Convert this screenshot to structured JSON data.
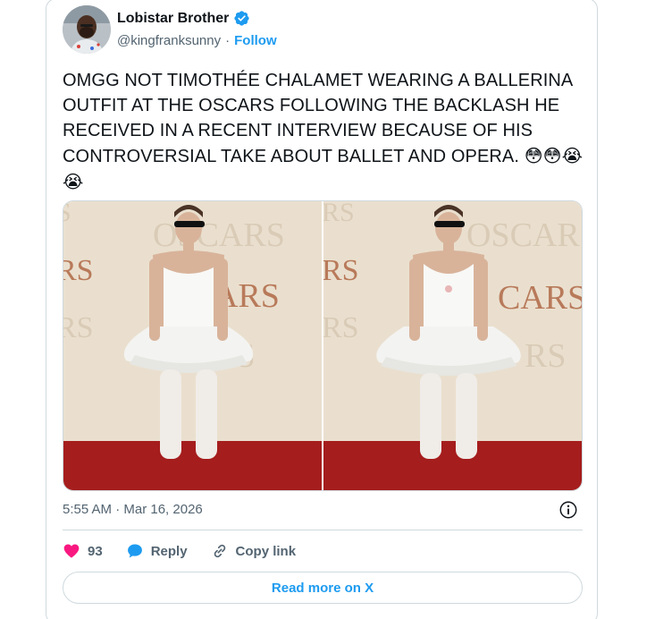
{
  "author": {
    "display_name": "Lobistar Brother",
    "handle": "@kingfranksunny",
    "separator": "·",
    "follow_label": "Follow"
  },
  "tweet": {
    "text": "OMGG NOT TIMOTHÉE CHALAMET WEARING A BALLERINA OUTFIT AT THE OSCARS FOLLOWING THE BACKLASH HE RECEIVED IN A RECENT INTERVIEW BECAUSE OF HIS CONTROVERSIAL TAKE ABOUT BALLET AND OPERA.",
    "emojis": "😳😳😭😭",
    "media": [
      {
        "name": "photo-1",
        "backdrop_text": "OSCARS"
      },
      {
        "name": "photo-2",
        "backdrop_text": "OSCARS"
      }
    ],
    "timestamp": "5:55 AM · Mar 16, 2026"
  },
  "actions": {
    "like_count": "93",
    "reply_label": "Reply",
    "copy_link_label": "Copy link"
  },
  "read_more_label": "Read more on X",
  "colors": {
    "accent": "#1d9bf0",
    "like": "#f91880",
    "text": "#0f1419",
    "secondary": "#536471",
    "border": "#cfd9de"
  }
}
